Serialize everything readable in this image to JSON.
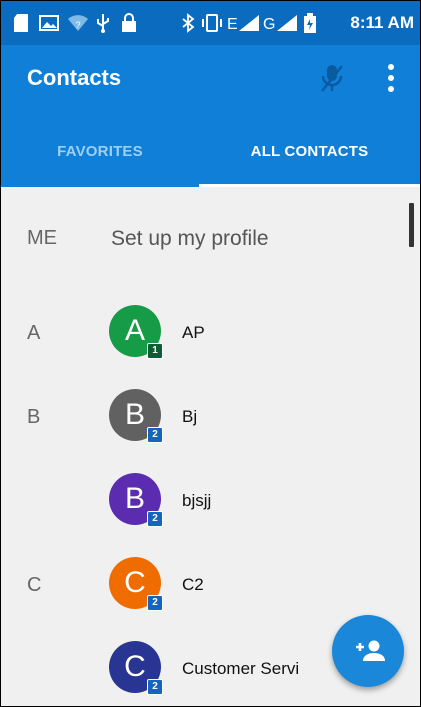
{
  "status_bar": {
    "time": "8:11 AM",
    "icons": [
      "sd-card-icon",
      "image-icon",
      "wifi-icon",
      "usb-icon",
      "lock-icon",
      "bluetooth-icon",
      "vibrate-icon",
      "signal-e-icon",
      "signal-g-icon",
      "battery-icon"
    ],
    "color": "#0b6bbf"
  },
  "app_bar": {
    "title": "Contacts",
    "color": "#0f7fd8",
    "tabs": [
      {
        "label": "FAVORITES",
        "selected": false
      },
      {
        "label": "ALL CONTACTS",
        "selected": true
      }
    ]
  },
  "me_section": {
    "letter": "ME",
    "label": "Set up my profile"
  },
  "contacts": [
    {
      "section": "A",
      "initial": "A",
      "name": "AP",
      "avatar_color": "#169c46",
      "badge": "1",
      "badge_color": "#0f5e33"
    },
    {
      "section": "B",
      "initial": "B",
      "name": "Bj",
      "avatar_color": "#616161",
      "badge": "2",
      "badge_color": "#1565c0"
    },
    {
      "section": "",
      "initial": "B",
      "name": "bjsjj",
      "avatar_color": "#5b2bb0",
      "badge": "2",
      "badge_color": "#1565c0"
    },
    {
      "section": "C",
      "initial": "C",
      "name": "C2",
      "avatar_color": "#ef6c00",
      "badge": "2",
      "badge_color": "#1565c0"
    },
    {
      "section": "",
      "initial": "C",
      "name": "Customer Servi",
      "avatar_color": "#283593",
      "badge": "2",
      "badge_color": "#1565c0"
    }
  ],
  "fab": {
    "icon": "add-person-icon",
    "color": "#1a87d9"
  }
}
